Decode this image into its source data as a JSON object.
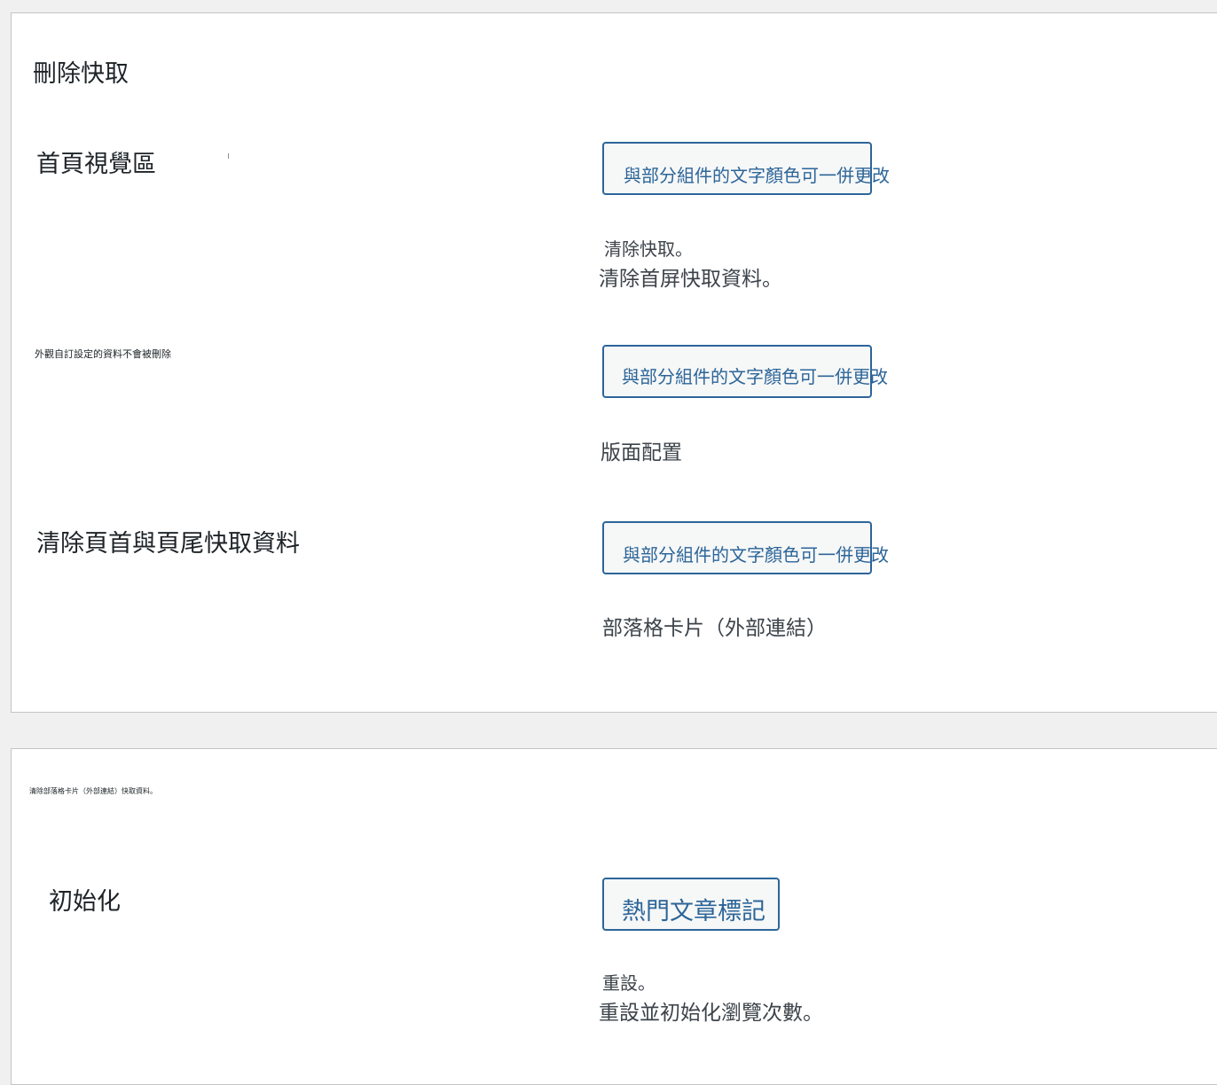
{
  "cache_panel": {
    "title": "刪除快取",
    "rows": [
      {
        "label": "首頁視覺區",
        "button_label": "與部分組件的文字顏色可一併更改",
        "desc_small": "清除快取。",
        "desc": "清除首屏快取資料。"
      },
      {
        "label": "外觀自訂設定的資料不會被刪除",
        "button_label": "與部分組件的文字顏色可一併更改",
        "desc": "版面配置"
      },
      {
        "label": "清除頁首與頁尾快取資料",
        "button_label": "與部分組件的文字顏色可一併更改",
        "desc": "部落格卡片（外部連結）"
      }
    ]
  },
  "init_panel": {
    "note": "清除部落格卡片（外部連結）快取資料。",
    "label": "初始化",
    "button_label": "熱門文章標記",
    "desc_small": "重設。",
    "desc": "重設並初始化瀏覽次數。"
  },
  "colors": {
    "page_bg": "#f0f0f1",
    "panel_bg": "#ffffff",
    "button_accent": "#2c6599",
    "button_bg": "#f6f7f7",
    "text": "#1d2327",
    "muted_text": "#3c434a"
  }
}
